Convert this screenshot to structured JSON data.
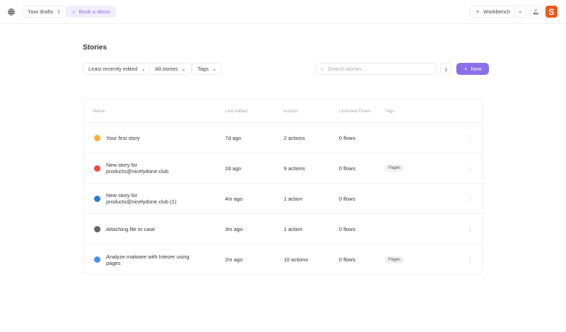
{
  "header": {
    "workspace": "Your drafts",
    "demo": "Book a demo",
    "workbench": "Workbench",
    "avatar_letter": "S"
  },
  "page": {
    "title": "Stories"
  },
  "filters": {
    "sort": "Least recently edited",
    "scope": "All stories",
    "tags": "Tags"
  },
  "search": {
    "placeholder": "Search stories..."
  },
  "new_label": "New",
  "table": {
    "columns": [
      "Name",
      "Last edited",
      "Actions",
      "Licensed Flows",
      "Tags"
    ],
    "rows": [
      {
        "name": "Your first story",
        "edited": "7d ago",
        "actions": "2 actions",
        "flows": "0 flows",
        "tag": "",
        "icon": "weather-icon",
        "color": "#f5b041"
      },
      {
        "name": "New story for products@nicelydone.club",
        "edited": "2d ago",
        "actions": "9 actions",
        "flows": "0 flows",
        "tag": "Pages",
        "icon": "calendar-icon",
        "color": "#e74c3c"
      },
      {
        "name": "New story for products@nicelydone.club (1)",
        "edited": "4m ago",
        "actions": "1 action",
        "flows": "0 flows",
        "tag": "",
        "icon": "globe-icon",
        "color": "#2e7bcf"
      },
      {
        "name": "Attaching file to case",
        "edited": "3m ago",
        "actions": "1 action",
        "flows": "0 flows",
        "tag": "",
        "icon": "satellite-icon",
        "color": "#666666"
      },
      {
        "name": "Analyze malware with Intezer using pages",
        "edited": "2m ago",
        "actions": "10 actions",
        "flows": "0 flows",
        "tag": "Pages",
        "icon": "bug-icon",
        "color": "#4a90e2"
      }
    ]
  }
}
